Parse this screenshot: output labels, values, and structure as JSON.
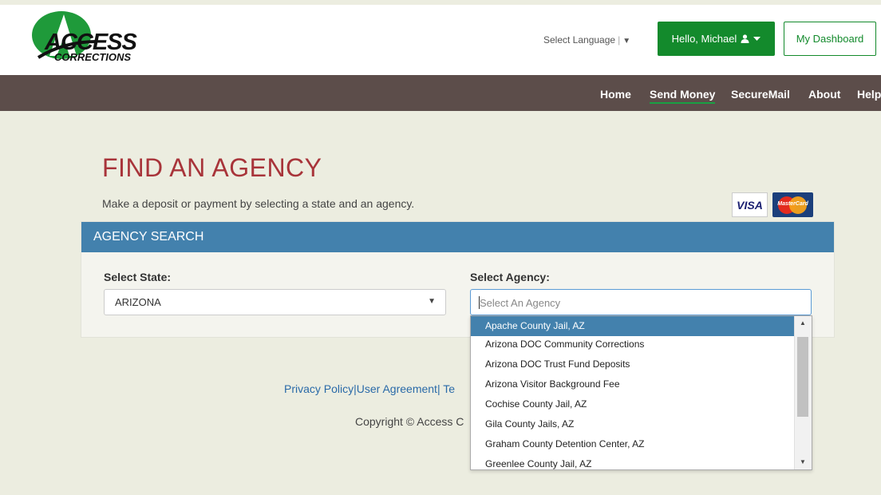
{
  "header": {
    "logo_line1": "ACCESS",
    "logo_line2": "CORRECTIONS",
    "language_label": "Select Language",
    "language_sep": "|",
    "language_arrow": "▼",
    "hello_label": "Hello, Michael",
    "dashboard_label": "My Dashboard",
    "brand_color": "#138a2c"
  },
  "nav": {
    "items": [
      "Home",
      "Send Money",
      "SecureMail",
      "About",
      "Help"
    ],
    "active": "Send Money"
  },
  "main": {
    "title": "FIND AN AGENCY",
    "subtitle": "Make a deposit or payment by selecting a state and an agency.",
    "visa_label": "VISA",
    "mastercard_label": "MasterCard"
  },
  "search": {
    "panel_title": "AGENCY SEARCH",
    "state_label": "Select State:",
    "state_value": "ARIZONA",
    "agency_label": "Select Agency:",
    "agency_placeholder": "Select An Agency",
    "options": [
      "Apache County Jail, AZ",
      "Arizona DOC Community Corrections",
      "Arizona DOC Trust Fund Deposits",
      "Arizona Visitor Background Fee",
      "Cochise County Jail, AZ",
      "Gila County Jails, AZ",
      "Graham County Detention Center, AZ",
      "Greenlee County Jail, AZ"
    ],
    "highlighted": "Apache County Jail, AZ"
  },
  "footer": {
    "privacy": "Privacy Policy",
    "sep1": "|",
    "agreement": "User Agreement",
    "sep2": "|",
    "terms_partial": " Te",
    "copyright": "Copyright © Access C"
  }
}
